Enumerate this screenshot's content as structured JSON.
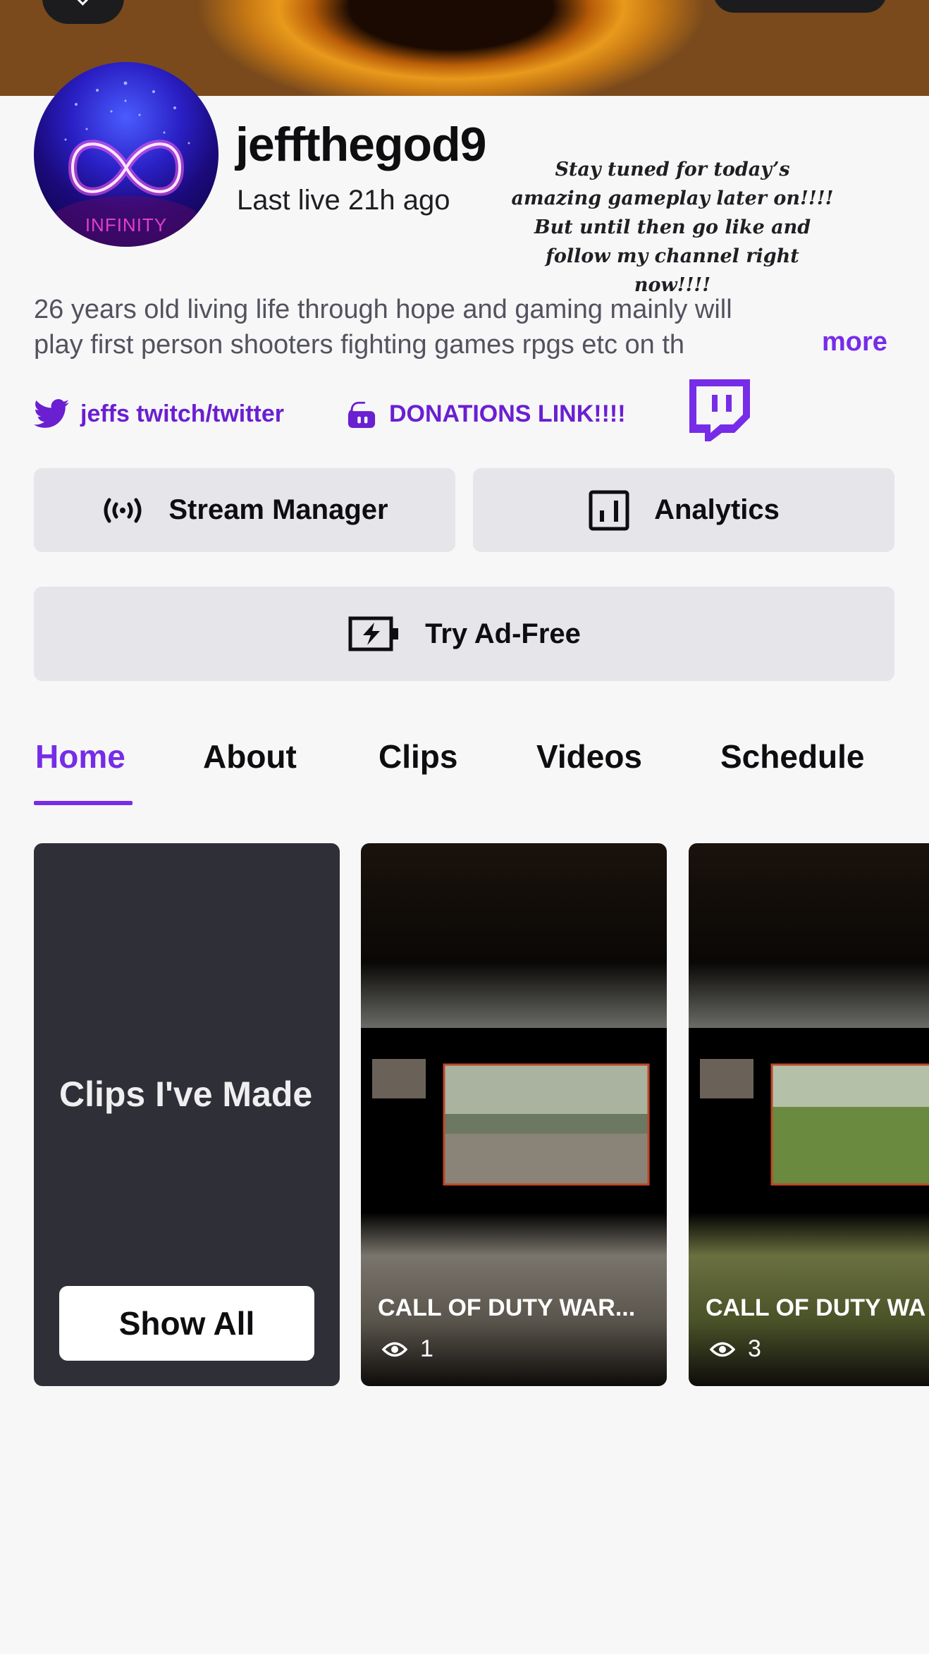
{
  "channel": {
    "name": "jeffthegod9",
    "status": "Last live 21h ago",
    "avatar_text": "INFINITY",
    "promo": "Stay tuned for today’s amazing gameplay later on!!!! But until then go like and follow my channel right now!!!!",
    "bio_line1": "26 years old living life through hope and gaming mainly will",
    "bio_line2": "play first person shooters fighting games rpgs etc on th",
    "more_label": "more"
  },
  "social_links": [
    {
      "label": "jeffs twitch/twitter",
      "icon": "twitter-bird-icon"
    },
    {
      "label": "DONATIONS LINK!!!!",
      "icon": "streamlabs-icon"
    }
  ],
  "actions": {
    "stream_manager": "Stream Manager",
    "analytics": "Analytics",
    "ad_free": "Try Ad-Free"
  },
  "tabs": [
    {
      "label": "Home",
      "active": true
    },
    {
      "label": "About"
    },
    {
      "label": "Clips"
    },
    {
      "label": "Videos"
    },
    {
      "label": "Schedule"
    }
  ],
  "clips_section": {
    "title": "Clips I've Made",
    "show_all": "Show All"
  },
  "clips": [
    {
      "title": "CALL OF DUTY WAR...",
      "views": "1"
    },
    {
      "title": "CALL OF DUTY WA",
      "views": "3"
    }
  ],
  "colors": {
    "accent": "#772ce8",
    "link": "#6a1fd1",
    "button_bg": "#e5e5ea",
    "card_dark": "#2f2f37"
  }
}
